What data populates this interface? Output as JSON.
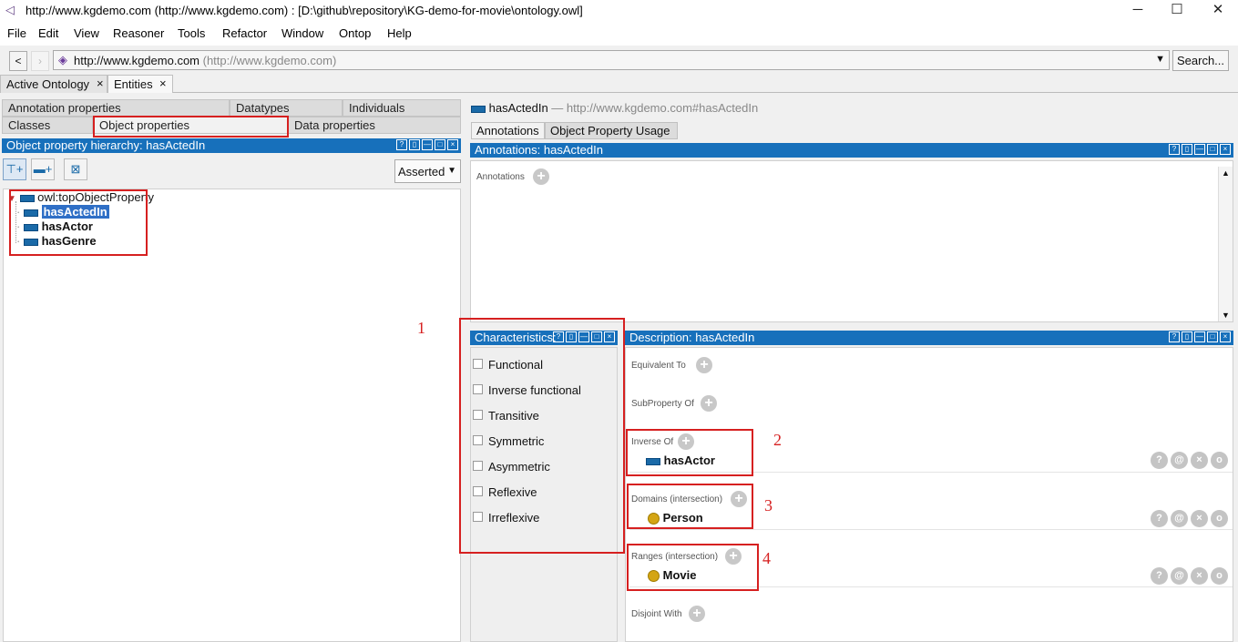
{
  "window": {
    "title": "http://www.kgdemo.com (http://www.kgdemo.com)  : [D:\\github\\repository\\KG-demo-for-movie\\ontology.owl]",
    "controls": {
      "minimize": "─",
      "maximize": "☐",
      "close": "✕"
    }
  },
  "menu": [
    "File",
    "Edit",
    "View",
    "Reasoner",
    "Tools",
    "Refactor",
    "Window",
    "Ontop",
    "Help"
  ],
  "address": {
    "back": "<",
    "forward": "›",
    "iri": "http://www.kgdemo.com",
    "iri_grey": "(http://www.kgdemo.com)",
    "dropdown": "▼",
    "search_button": "Search..."
  },
  "tabs": [
    {
      "label": "Active Ontology",
      "close": "×"
    },
    {
      "label": "Entities",
      "close": "×"
    }
  ],
  "left": {
    "subtabs_row1": [
      "Annotation properties",
      "Datatypes",
      "Individuals"
    ],
    "subtabs_row2": [
      "Classes",
      "Object properties",
      "Data properties"
    ],
    "view_title": "Object property hierarchy: hasActedIn",
    "asserted": "Asserted",
    "tree": {
      "root": "owl:topObjectProperty",
      "children": [
        "hasActedIn",
        "hasActor",
        "hasGenre"
      ]
    }
  },
  "right": {
    "entity_name": "hasActedIn",
    "entity_iri": "— http://www.kgdemo.com#hasActedIn",
    "tabs": [
      "Annotations",
      "Object Property Usage"
    ],
    "annotations_header": "Annotations: hasActedIn",
    "annotations_label": "Annotations",
    "characteristics_header": "Characteristics:",
    "characteristics": [
      "Functional",
      "Inverse functional",
      "Transitive",
      "Symmetric",
      "Asymmetric",
      "Reflexive",
      "Irreflexive"
    ],
    "description_header": "Description: hasActedIn",
    "sections": {
      "equivalent_to": "Equivalent To",
      "subproperty_of": "SubProperty Of",
      "inverse_of": "Inverse Of",
      "inverse_value": "hasActor",
      "domains": "Domains (intersection)",
      "domain_value": "Person",
      "ranges": "Ranges (intersection)",
      "range_value": "Movie",
      "disjoint_with": "Disjoint With"
    },
    "row_buttons": [
      "?",
      "@",
      "×",
      "o"
    ]
  },
  "callouts": [
    "1",
    "2",
    "3",
    "4"
  ],
  "header_icons": [
    "?",
    "▯",
    "—",
    "□",
    "×"
  ]
}
